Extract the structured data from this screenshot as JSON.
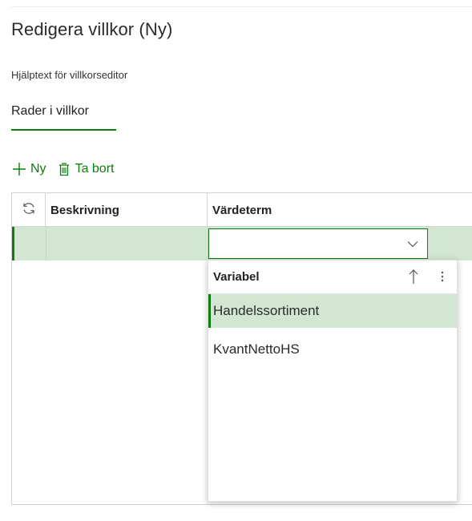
{
  "page": {
    "title": "Redigera villkor (Ny)",
    "help_text": "Hjälptext för villkorseditor"
  },
  "tabs": [
    {
      "label": "Rader i villkor",
      "selected": true
    }
  ],
  "toolbar": {
    "new_label": "Ny",
    "new_icon": "plus-icon",
    "delete_label": "Ta bort",
    "delete_icon": "trash-icon"
  },
  "grid": {
    "columns": [
      {
        "key": "refresh",
        "icon": "refresh-icon"
      },
      {
        "key": "description",
        "label": "Beskrivning"
      },
      {
        "key": "value_term",
        "label": "Värdeterm"
      }
    ],
    "rows": [
      {
        "description": "",
        "value_term": "",
        "selected": true
      }
    ]
  },
  "lookup": {
    "input_value": "",
    "column_label": "Variabel",
    "sort_icon": "arrow-up-icon",
    "more_icon": "more-vertical-icon",
    "items": [
      {
        "label": "Handelssortiment",
        "selected": true
      },
      {
        "label": "KvantNettoHS",
        "selected": false
      }
    ]
  },
  "colors": {
    "accent": "#107c10",
    "selected_row": "#d2e6d2",
    "border": "#d4d4d4"
  }
}
